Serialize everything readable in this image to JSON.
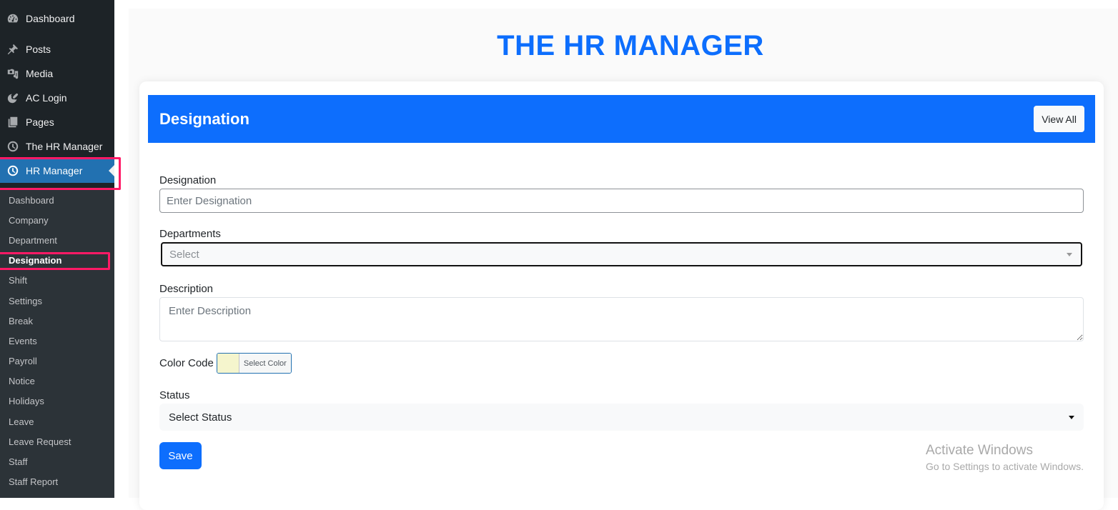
{
  "sidebar": {
    "items": [
      {
        "label": "Dashboard",
        "icon": "dashboard-icon"
      },
      {
        "label": "Posts",
        "icon": "pin-icon"
      },
      {
        "label": "Media",
        "icon": "media-icon"
      },
      {
        "label": "AC Login",
        "icon": "palette-icon"
      },
      {
        "label": "Pages",
        "icon": "pages-icon"
      },
      {
        "label": "The HR Manager",
        "icon": "clock-icon"
      },
      {
        "label": "HR Manager",
        "icon": "clock-icon",
        "current": true
      }
    ],
    "submenu": [
      {
        "label": "Dashboard"
      },
      {
        "label": "Company"
      },
      {
        "label": "Department"
      },
      {
        "label": "Designation",
        "active": true
      },
      {
        "label": "Shift"
      },
      {
        "label": "Settings"
      },
      {
        "label": "Break"
      },
      {
        "label": "Events"
      },
      {
        "label": "Payroll"
      },
      {
        "label": "Notice"
      },
      {
        "label": "Holidays"
      },
      {
        "label": "Leave"
      },
      {
        "label": "Leave Request"
      },
      {
        "label": "Staff"
      },
      {
        "label": "Staff Report"
      }
    ]
  },
  "app_title": "THE HR MANAGER",
  "card": {
    "title": "Designation",
    "view_all_label": "View All"
  },
  "form": {
    "designation": {
      "label": "Designation",
      "placeholder": "Enter Designation",
      "value": ""
    },
    "departments": {
      "label": "Departments",
      "placeholder": "Select",
      "value": ""
    },
    "description": {
      "label": "Description",
      "placeholder": "Enter Description",
      "value": ""
    },
    "color_code": {
      "label": "Color Code",
      "button_label": "Select Color",
      "value": "#f5f5cd"
    },
    "status": {
      "label": "Status",
      "selected": "Select Status"
    },
    "save_label": "Save"
  },
  "colors": {
    "accent": "#0d6efd",
    "wp_sidebar": "#1d2327",
    "wp_submenu": "#2c3338",
    "wp_current": "#2271b1",
    "highlight": "#ff1a66"
  },
  "watermark": {
    "line1": "Activate Windows",
    "line2": "Go to Settings to activate Windows."
  }
}
